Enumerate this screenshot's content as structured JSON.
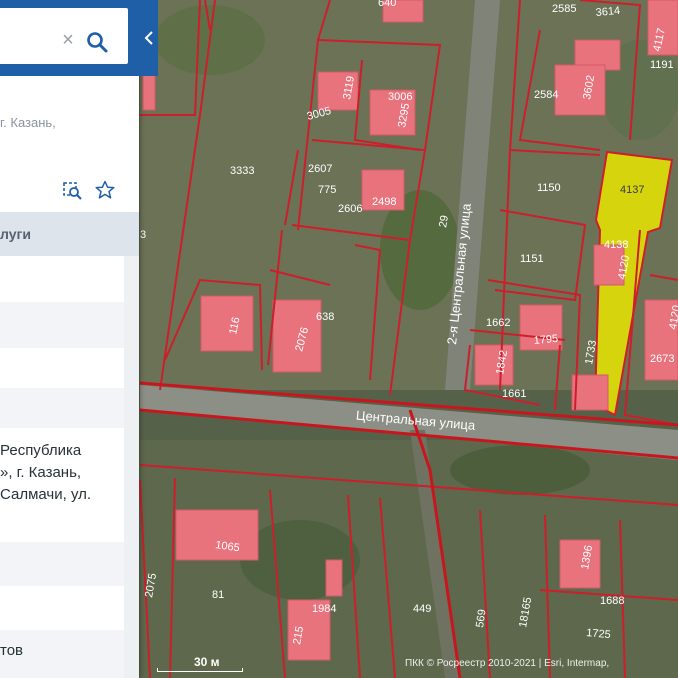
{
  "search": {
    "placeholder": ""
  },
  "info_panel": {
    "address_short": "г. Казань,",
    "section_header": "луги",
    "address_lines": [
      "Республика",
      "», г. Казань,",
      "Салмачи, ул."
    ],
    "bottom_text": "тов"
  },
  "map": {
    "scale_label": "30 м",
    "copyright": "ПКК © Росреестр 2010-2021 | Esri, Intermap,",
    "streets": {
      "central": "Центральная улица",
      "second_central": "2-я Центральная улица"
    },
    "selected_parcel": "4137",
    "parcel_labels": [
      "640",
      "2585",
      "3614",
      "4117",
      "1191",
      "3119",
      "3006",
      "3005",
      "3295",
      "2584",
      "3602",
      "3333",
      "2607",
      "775",
      "2606",
      "2498",
      "1150",
      "4137",
      "29",
      "4138",
      "4120",
      "3",
      "1151",
      "116",
      "638",
      "2076",
      "1662",
      "1795",
      "1842",
      "1733",
      "2673",
      "4120",
      "1661",
      "1065",
      "1396",
      "2075",
      "81",
      "1984",
      "215",
      "449",
      "569",
      "18165",
      "1688",
      "1725"
    ],
    "colors": {
      "panel_header": "#1e5fa8",
      "selected_fill": "#e9e600",
      "boundary": "#cc1f2b",
      "building": "#e9737d"
    }
  }
}
